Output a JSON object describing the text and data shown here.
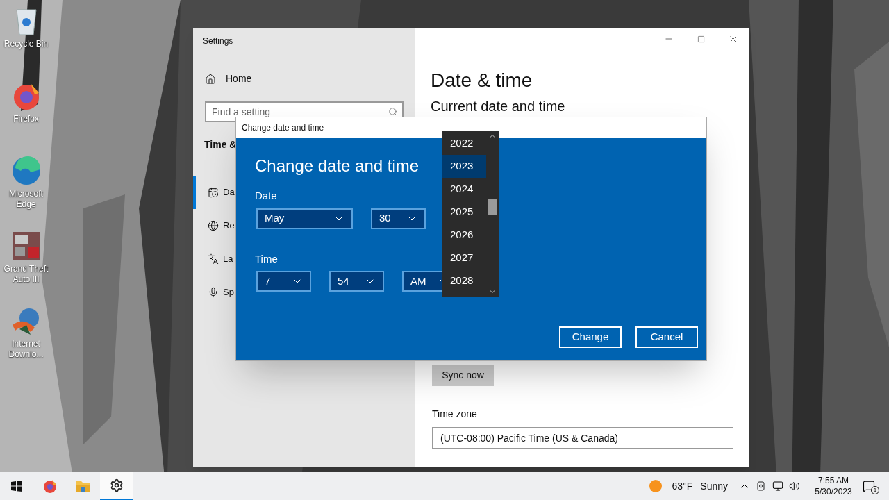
{
  "desktop": {
    "icons": [
      {
        "label": "Recycle Bin",
        "kind": "bin"
      },
      {
        "label": "Firefox",
        "kind": "firefox"
      },
      {
        "label": "Microsoft Edge",
        "kind": "edge"
      },
      {
        "label": "Grand Theft Auto III",
        "kind": "game"
      },
      {
        "label": "Internet Downlo...",
        "kind": "download"
      }
    ]
  },
  "settings": {
    "title": "Settings",
    "home": "Home",
    "search": {
      "placeholder": "Find a setting"
    },
    "section": "Time &",
    "nav": [
      {
        "label": "Da",
        "selected": true,
        "kind": "calendar"
      },
      {
        "label": "Re",
        "selected": false,
        "kind": "globe"
      },
      {
        "label": "La",
        "selected": false,
        "kind": "language"
      },
      {
        "label": "Sp",
        "selected": false,
        "kind": "mic"
      }
    ],
    "page_title": "Date & time",
    "subtitle": "Current date and time",
    "sync_button": "Sync now",
    "time_zone": {
      "label": "Time zone",
      "value": "(UTC-08:00) Pacific Time (US & Canada)"
    }
  },
  "dialog": {
    "title": "Change date and time",
    "heading": "Change date and time",
    "date_label": "Date",
    "month": "May",
    "day": "30",
    "time_label": "Time",
    "hour": "7",
    "minute": "54",
    "period": "AM",
    "buttons": [
      "Change",
      "Cancel"
    ]
  },
  "year_list": [
    {
      "label": "2022",
      "selected": false
    },
    {
      "label": "2023",
      "selected": true
    },
    {
      "label": "2024",
      "selected": false
    },
    {
      "label": "2025",
      "selected": false
    },
    {
      "label": "2026",
      "selected": false
    },
    {
      "label": "2027",
      "selected": false
    },
    {
      "label": "2028",
      "selected": false
    }
  ],
  "taskbar": {
    "apps": [
      {
        "kind": "firefox",
        "selected": false
      },
      {
        "kind": "folder",
        "selected": false
      },
      {
        "kind": "settings",
        "selected": true
      }
    ],
    "weather": {
      "temp": "63°F",
      "condition": "Sunny"
    },
    "time": "7:55 AM",
    "date": "5/30/2023",
    "notification_count": "1"
  }
}
